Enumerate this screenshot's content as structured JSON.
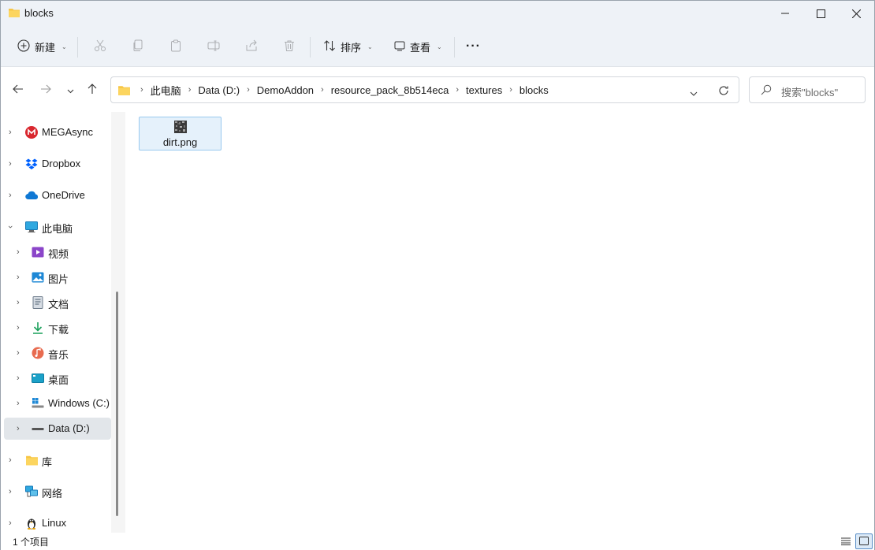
{
  "window": {
    "title": "blocks",
    "controls": {
      "minimize": "—",
      "maximize": "☐",
      "close": "✕"
    }
  },
  "toolbar": {
    "new_label": "新建",
    "sort_label": "排序",
    "view_label": "查看",
    "more_label": "···"
  },
  "address": {
    "crumbs": [
      "此电脑",
      "Data (D:)",
      "DemoAddon",
      "resource_pack_8b514eca",
      "textures",
      "blocks"
    ]
  },
  "search": {
    "placeholder": "搜索\"blocks\""
  },
  "sidebar": {
    "items": [
      {
        "label": "MEGAsync",
        "icon": "mega-icon"
      },
      {
        "label": "Dropbox",
        "icon": "dropbox-icon"
      },
      {
        "label": "OneDrive",
        "icon": "onedrive-icon"
      },
      {
        "label": "此电脑",
        "icon": "computer-icon"
      },
      {
        "label": "视频",
        "icon": "video-icon"
      },
      {
        "label": "图片",
        "icon": "pictures-icon"
      },
      {
        "label": "文档",
        "icon": "documents-icon"
      },
      {
        "label": "下载",
        "icon": "download-icon"
      },
      {
        "label": "音乐",
        "icon": "music-icon"
      },
      {
        "label": "桌面",
        "icon": "desktop-icon"
      },
      {
        "label": "Windows (C:)",
        "icon": "windows-drive-icon"
      },
      {
        "label": "Data (D:)",
        "icon": "drive-icon"
      },
      {
        "label": "库",
        "icon": "library-icon"
      },
      {
        "label": "网络",
        "icon": "network-icon"
      },
      {
        "label": "Linux",
        "icon": "linux-icon"
      }
    ]
  },
  "files": [
    {
      "name": "dirt.png"
    }
  ],
  "status": {
    "count_text": "1 个项目"
  },
  "colors": {
    "accent": "#0067c0",
    "selection": "#e5f1fb",
    "selection_border": "#99c9ef"
  }
}
